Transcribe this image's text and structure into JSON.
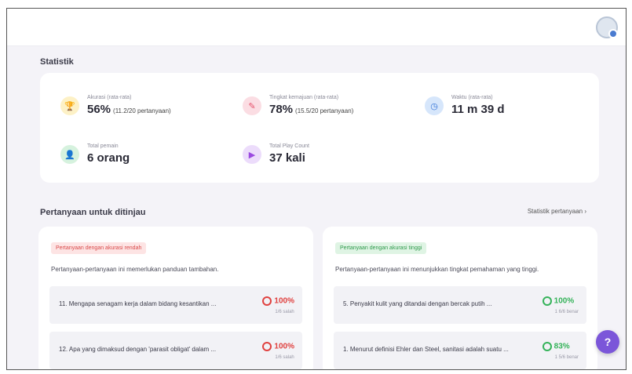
{
  "colors": {
    "trophy": "#f5c518",
    "trophy_bg": "#fdf1c6",
    "pencil": "#e6516b",
    "pencil_bg": "#fbdde3",
    "clock": "#2e6fd6",
    "clock_bg": "#d6e6fb",
    "person": "#3fb562",
    "person_bg": "#d6f2de",
    "play": "#9b4ae0",
    "play_bg": "#ecdcfb",
    "low_ring": "#e0413f",
    "high_ring": "#35b35a",
    "low_tag_bg": "#fde4e4",
    "low_tag_fg": "#d94a4a",
    "high_tag_bg": "#dff4e4",
    "high_tag_fg": "#2f9a4c",
    "help_button": "#7b56d9"
  },
  "statistics": {
    "title": "Statistik",
    "accuracy": {
      "icon": "trophy-icon",
      "label": "Akurasi (rata-rata)",
      "value": "56%",
      "sub": "(11.2/20 pertanyaan)"
    },
    "progress": {
      "icon": "pencil-icon",
      "label": "Tingkat kemajuan (rata-rata)",
      "value": "78%",
      "sub": "(15.5/20 pertanyaan)"
    },
    "time": {
      "icon": "clock-icon",
      "label": "Waktu (rata-rata)",
      "value": "11 m 39 d"
    },
    "players": {
      "icon": "person-icon",
      "label": "Total pemain",
      "value": "6 orang"
    },
    "play_count": {
      "icon": "play-icon",
      "label": "Total Play Count",
      "value": "37 kali"
    }
  },
  "review": {
    "title": "Pertanyaan untuk ditinjau",
    "link": "Statistik pertanyaan ›",
    "low": {
      "tag": "Pertanyaan dengan akurasi rendah",
      "desc": "Pertanyaan-pertanyaan ini memerlukan panduan tambahan.",
      "items": [
        {
          "text": "11. Mengapa senagam kerja dalam bidang kesantikan ...",
          "pct": "100%",
          "sub": "1/6 salah"
        },
        {
          "text": "12. Apa yang dimaksud dengan 'parasit obligat' dalam ...",
          "pct": "100%",
          "sub": "1/6 salah"
        }
      ]
    },
    "high": {
      "tag": "Pertanyaan dengan akurasi tinggi",
      "desc": "Pertanyaan-pertanyaan ini menunjukkan tingkat pemahaman yang tinggi.",
      "items": [
        {
          "text": "5. Penyakit kulit yang ditandai dengan bercak putih ...",
          "pct": "100%",
          "sub": "1 6/6 benar"
        },
        {
          "text": "1. Menurut definisi Ehler dan Steel, sanitasi adalah suatu ...",
          "pct": "83%",
          "sub": "1 5/6 benar"
        }
      ]
    }
  },
  "help": {
    "label": "?"
  }
}
